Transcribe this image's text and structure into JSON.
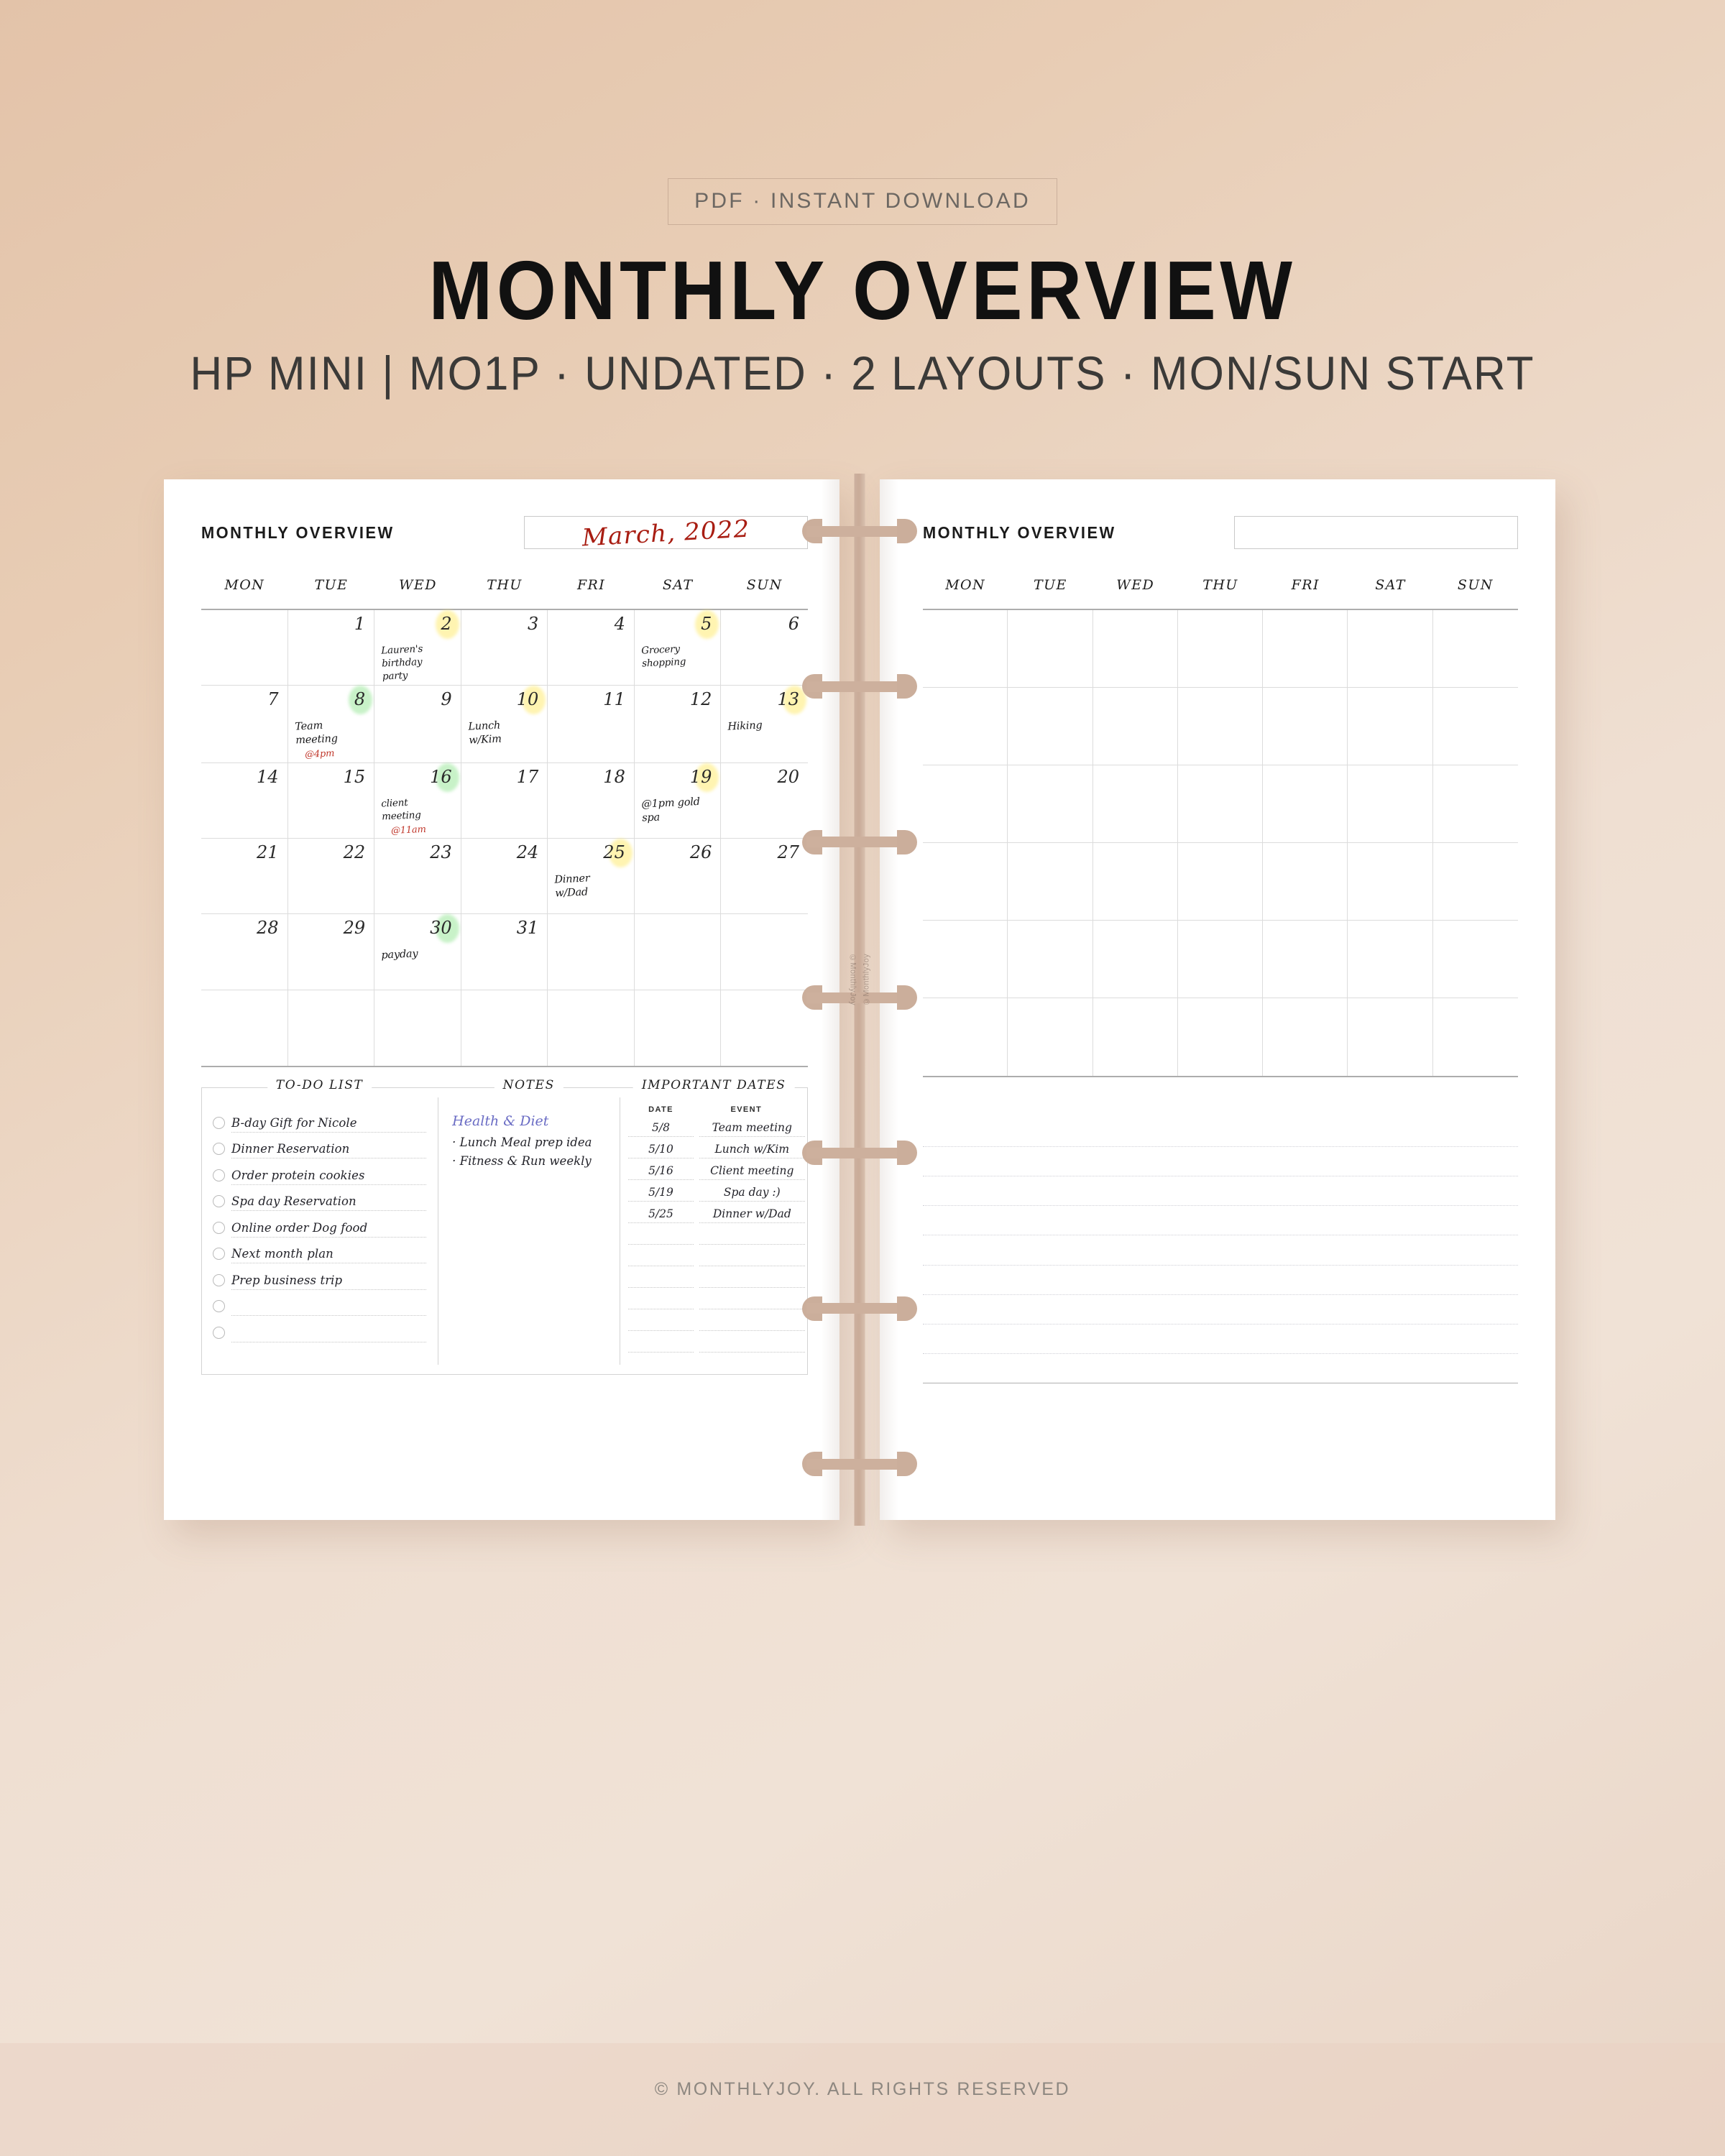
{
  "header": {
    "badge": "PDF · INSTANT DOWNLOAD",
    "title": "MONTHLY OVERVIEW",
    "subtitle": "HP MINI | MO1P · UNDATED · 2 LAYOUTS · MON/SUN START"
  },
  "footer": {
    "copyright": "© MONTHLYJOY. ALL RIGHTS RESERVED"
  },
  "colors": {
    "background_top": "#e3c3a9",
    "background_bottom": "#e9d5c6",
    "page": "#ffffff",
    "ring": "#cdb09d",
    "accent_red": "#a81d12",
    "entry_time_red": "#c0372b",
    "notes_purple": "#6a6cc4",
    "highlight_yellow": "#ffec78",
    "highlight_green": "#96e696",
    "grid_line": "#dcdcdc",
    "grid_edge": "#adadad"
  },
  "binding": {
    "spine_watermark": "©MonthlyJoy",
    "ring_count": 7
  },
  "left_page": {
    "title": "MONTHLY OVERVIEW",
    "month_value": "March, 2022",
    "month_placeholder": "",
    "weekdays": [
      "MON",
      "TUE",
      "WED",
      "THU",
      "FRI",
      "SAT",
      "SUN"
    ],
    "cells": [
      {
        "day": "",
        "highlight": "",
        "entry": "",
        "time": ""
      },
      {
        "day": "1",
        "highlight": "",
        "entry": "",
        "time": ""
      },
      {
        "day": "2",
        "highlight": "yellow",
        "entry": "Lauren's birthday party",
        "time": ""
      },
      {
        "day": "3",
        "highlight": "",
        "entry": "",
        "time": ""
      },
      {
        "day": "4",
        "highlight": "",
        "entry": "",
        "time": ""
      },
      {
        "day": "5",
        "highlight": "yellow",
        "entry": "Grocery shopping",
        "time": ""
      },
      {
        "day": "6",
        "highlight": "",
        "entry": "",
        "time": ""
      },
      {
        "day": "7",
        "highlight": "",
        "entry": "",
        "time": ""
      },
      {
        "day": "8",
        "highlight": "green",
        "entry": "Team meeting",
        "time": "@4pm"
      },
      {
        "day": "9",
        "highlight": "",
        "entry": "",
        "time": ""
      },
      {
        "day": "10",
        "highlight": "yellow",
        "entry": "Lunch w/Kim",
        "time": ""
      },
      {
        "day": "11",
        "highlight": "",
        "entry": "",
        "time": ""
      },
      {
        "day": "12",
        "highlight": "",
        "entry": "",
        "time": ""
      },
      {
        "day": "13",
        "highlight": "yellow",
        "entry": "Hiking",
        "time": ""
      },
      {
        "day": "14",
        "highlight": "",
        "entry": "",
        "time": ""
      },
      {
        "day": "15",
        "highlight": "",
        "entry": "",
        "time": ""
      },
      {
        "day": "16",
        "highlight": "green",
        "entry": "client meeting",
        "time": "@11am"
      },
      {
        "day": "17",
        "highlight": "",
        "entry": "",
        "time": ""
      },
      {
        "day": "18",
        "highlight": "",
        "entry": "",
        "time": ""
      },
      {
        "day": "19",
        "highlight": "yellow",
        "entry": "@1pm gold spa",
        "time": ""
      },
      {
        "day": "20",
        "highlight": "",
        "entry": "",
        "time": ""
      },
      {
        "day": "21",
        "highlight": "",
        "entry": "",
        "time": ""
      },
      {
        "day": "22",
        "highlight": "",
        "entry": "",
        "time": ""
      },
      {
        "day": "23",
        "highlight": "",
        "entry": "",
        "time": ""
      },
      {
        "day": "24",
        "highlight": "",
        "entry": "",
        "time": ""
      },
      {
        "day": "25",
        "highlight": "yellow",
        "entry": "Dinner w/Dad",
        "time": ""
      },
      {
        "day": "26",
        "highlight": "",
        "entry": "",
        "time": ""
      },
      {
        "day": "27",
        "highlight": "",
        "entry": "",
        "time": ""
      },
      {
        "day": "28",
        "highlight": "",
        "entry": "",
        "time": ""
      },
      {
        "day": "29",
        "highlight": "",
        "entry": "",
        "time": ""
      },
      {
        "day": "30",
        "highlight": "green",
        "entry": "payday",
        "time": ""
      },
      {
        "day": "31",
        "highlight": "",
        "entry": "",
        "time": ""
      },
      {
        "day": "",
        "highlight": "",
        "entry": "",
        "time": ""
      },
      {
        "day": "",
        "highlight": "",
        "entry": "",
        "time": ""
      },
      {
        "day": "",
        "highlight": "",
        "entry": "",
        "time": ""
      },
      {
        "day": "",
        "highlight": "",
        "entry": "",
        "time": ""
      },
      {
        "day": "",
        "highlight": "",
        "entry": "",
        "time": ""
      },
      {
        "day": "",
        "highlight": "",
        "entry": "",
        "time": ""
      },
      {
        "day": "",
        "highlight": "",
        "entry": "",
        "time": ""
      },
      {
        "day": "",
        "highlight": "",
        "entry": "",
        "time": ""
      },
      {
        "day": "",
        "highlight": "",
        "entry": "",
        "time": ""
      },
      {
        "day": "",
        "highlight": "",
        "entry": "",
        "time": ""
      }
    ],
    "todo": {
      "title": "TO-DO LIST",
      "items": [
        "B-day Gift for Nicole",
        "Dinner Reservation",
        "Order protein cookies",
        "Spa day Reservation",
        "Online order Dog food",
        "Next month plan",
        "Prep business trip",
        "",
        ""
      ]
    },
    "notes": {
      "title": "NOTES",
      "heading": "Health & Diet",
      "lines": [
        "· Lunch Meal prep idea",
        "· Fitness & Run weekly"
      ]
    },
    "important_dates": {
      "title": "IMPORTANT DATES",
      "columns": [
        "DATE",
        "EVENT"
      ],
      "rows": [
        {
          "date": "5/8",
          "event": "Team meeting"
        },
        {
          "date": "5/10",
          "event": "Lunch w/Kim"
        },
        {
          "date": "5/16",
          "event": "Client meeting"
        },
        {
          "date": "5/19",
          "event": "Spa day :)"
        },
        {
          "date": "5/25",
          "event": "Dinner w/Dad"
        },
        {
          "date": "",
          "event": ""
        },
        {
          "date": "",
          "event": ""
        },
        {
          "date": "",
          "event": ""
        },
        {
          "date": "",
          "event": ""
        },
        {
          "date": "",
          "event": ""
        },
        {
          "date": "",
          "event": ""
        }
      ]
    }
  },
  "right_page": {
    "title": "MONTHLY OVERVIEW",
    "month_value": "",
    "weekdays": [
      "MON",
      "TUE",
      "WED",
      "THU",
      "FRI",
      "SAT",
      "SUN"
    ],
    "week_rows": 6,
    "note_lines": 9
  }
}
